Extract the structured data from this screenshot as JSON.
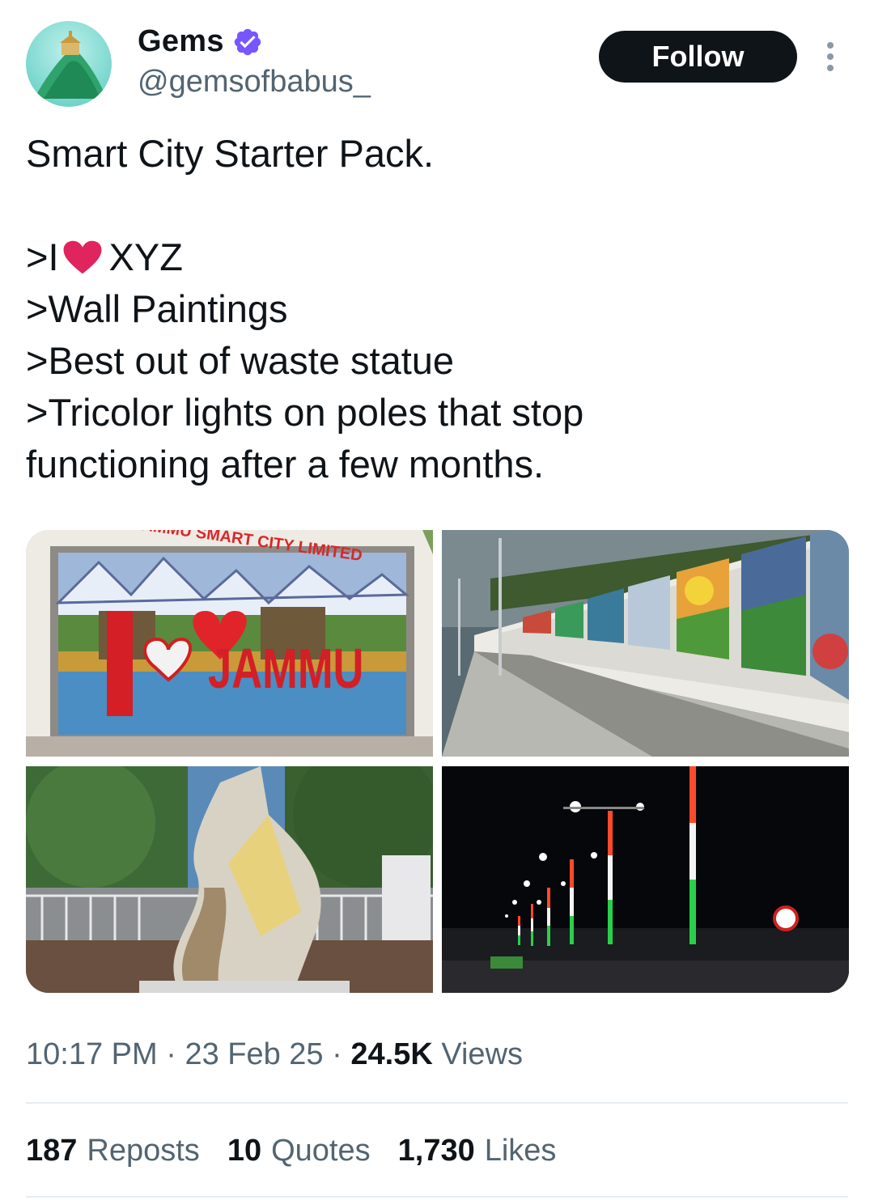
{
  "author": {
    "name": "Gems",
    "handle": "@gemsofbabus_",
    "verified": true,
    "verified_color": "#7856ff"
  },
  "actions": {
    "follow_label": "Follow",
    "more_icon": "more-vertical-icon"
  },
  "tweet": {
    "line1": "Smart City Starter Pack.",
    "line2_prefix": ">I",
    "line2_emoji": "heart-icon",
    "line2_suffix": "XYZ",
    "line3": ">Wall Paintings",
    "line4": ">Best out of waste statue",
    "line5": ">Tricolor lights on poles that stop",
    "line6": "functioning after a few months."
  },
  "media": {
    "image1_sign_text": "JAMMU SMART CITY LIMITED",
    "image1_word": "JAMMU",
    "image1_letter": "I"
  },
  "meta": {
    "time": "10:17 PM",
    "sep1": "·",
    "date": "23 Feb 25",
    "sep2": "·",
    "views_count": "24.5K",
    "views_label": "Views"
  },
  "stats": {
    "reposts_count": "187",
    "reposts_label": "Reposts",
    "quotes_count": "10",
    "quotes_label": "Quotes",
    "likes_count": "1,730",
    "likes_label": "Likes"
  },
  "colors": {
    "text_primary": "#0f1419",
    "text_secondary": "#536471",
    "follow_bg": "#0f1419",
    "divider": "#e6ecf0",
    "heart": "#e0245e"
  }
}
